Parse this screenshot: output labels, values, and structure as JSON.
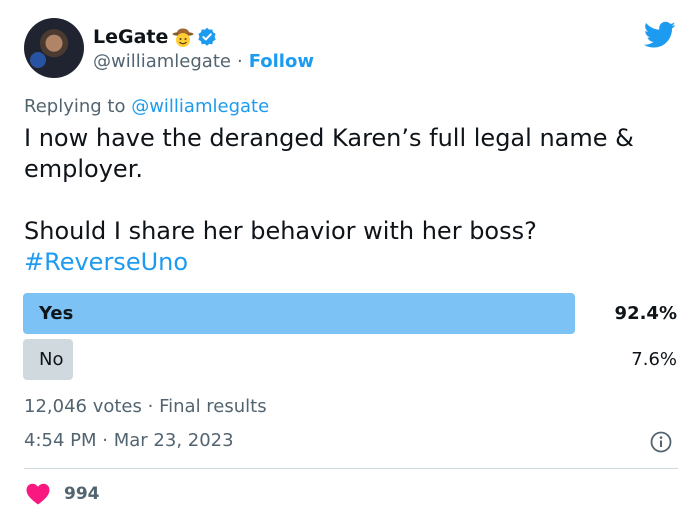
{
  "author": {
    "display_name": "LeGate",
    "handle": "@williamlegate",
    "separator": "·",
    "follow_label": "Follow",
    "badge_emoji": "cowboy-hat-face",
    "verified": true
  },
  "reply": {
    "prefix": "Replying to ",
    "mention": "@williamlegate"
  },
  "tweet": {
    "line1": "I now have the deranged Karen’s full legal name & employer.",
    "line2": "Should I share her behavior with her boss?",
    "hashtag": "#ReverseUno"
  },
  "poll": {
    "options": [
      {
        "label": "Yes",
        "percent_text": "92.4%",
        "percent": 92.4,
        "winner": true
      },
      {
        "label": "No",
        "percent_text": "7.6%",
        "percent": 7.6,
        "winner": false
      }
    ],
    "votes": "12,046 votes",
    "separator": "·",
    "status": "Final results"
  },
  "meta": {
    "time": "4:54 PM",
    "separator": "·",
    "date": "Mar 23, 2023"
  },
  "engagement": {
    "likes": "994"
  },
  "colors": {
    "accent": "#1d9bf0",
    "winner_bar": "#7cc2f5",
    "loser_bar": "#cfd9de",
    "heart": "#f91880"
  },
  "icons": {
    "brand": "twitter-bird-icon",
    "info": "info-icon",
    "like": "heart-icon"
  }
}
